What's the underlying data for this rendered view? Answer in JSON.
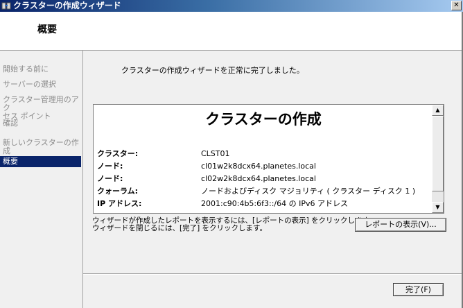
{
  "window": {
    "title": "クラスターの作成ウィザード",
    "icon": "cluster-app-icon"
  },
  "header": {
    "title": "概要"
  },
  "nav": {
    "items": [
      {
        "label": "開始する前に",
        "state": "disabled"
      },
      {
        "label": "サーバーの選択",
        "state": "disabled"
      },
      {
        "label": "クラスター管理用のアクセス ポイント",
        "line1": "クラスター管理用のアク",
        "line2": "セス ポイント",
        "state": "disabled"
      },
      {
        "label": "確認",
        "state": "disabled"
      },
      {
        "label": "新しいクラスターの作成",
        "state": "disabled"
      },
      {
        "label": "概要",
        "state": "selected"
      }
    ]
  },
  "main": {
    "message": "クラスターの作成ウィザードを正常に完了しました。",
    "report": {
      "title": "クラスターの作成",
      "rows": [
        {
          "key": "クラスター:",
          "value": "CLST01"
        },
        {
          "key": "ノード:",
          "value": "cl01w2k8dcx64.planetes.local"
        },
        {
          "key": "ノード:",
          "value": "cl02w2k8dcx64.planetes.local"
        },
        {
          "key": "クォーラム:",
          "value": "ノードおよびディスク マジョリティ ( クラスター ディスク 1 )"
        },
        {
          "key": "IP アドレス:",
          "value": "2001:c90:4b5:6f3::/64 の IPv6 アドレス"
        }
      ]
    },
    "hint_line1": "ウィザードが作成したレポートを表示するには、[レポートの表示] をクリックします。",
    "hint_line2": "ウィザードを閉じるには、[完了] をクリックします。",
    "view_report_button": "レポートの表示(V)...",
    "finish_button": "完了(F)"
  },
  "colors": {
    "selected_nav": "#0a246a",
    "panel": "#f0f0f0",
    "disabled_text": "#8a8a8a"
  }
}
